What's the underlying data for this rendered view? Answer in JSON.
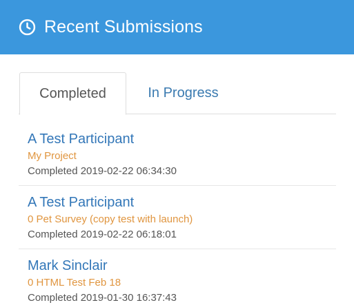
{
  "header": {
    "icon": "clock-icon",
    "title": "Recent Submissions",
    "background": "#3b97dd"
  },
  "tabs": [
    {
      "label": "Completed",
      "active": true
    },
    {
      "label": "In Progress",
      "active": false
    }
  ],
  "submissions": [
    {
      "participant": "A Test Participant",
      "project": "My Project",
      "status": "Completed 2019-02-22 06:34:30"
    },
    {
      "participant": "A Test Participant",
      "project": "0 Pet Survey (copy test with launch)",
      "status": "Completed 2019-02-22 06:18:01"
    },
    {
      "participant": "Mark Sinclair",
      "project": "0 HTML Test Feb 18",
      "status": "Completed 2019-01-30 16:37:43"
    }
  ],
  "colors": {
    "accent": "#3b97dd",
    "link": "#3377b8",
    "project": "#e0953f",
    "muted": "#555555"
  }
}
